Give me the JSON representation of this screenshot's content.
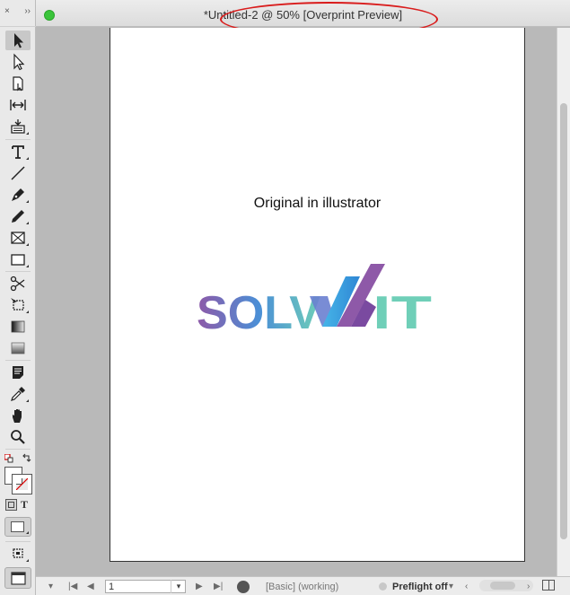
{
  "window": {
    "title": "*Untitled-2 @ 50% [Overprint Preview]"
  },
  "tools_panel": {
    "collapse_glyph": "››",
    "close_glyph": "×",
    "tools": [
      {
        "name": "selection-tool",
        "icon": "arrow-icon"
      },
      {
        "name": "direct-selection-tool",
        "icon": "hollow-arrow-icon"
      },
      {
        "name": "page-tool",
        "icon": "page-icon"
      },
      {
        "name": "gap-tool",
        "icon": "gap-icon"
      },
      {
        "name": "content-collector-tool",
        "icon": "collector-icon"
      },
      {
        "name": "type-tool",
        "icon": "type-icon"
      },
      {
        "name": "line-tool",
        "icon": "line-icon"
      },
      {
        "name": "pen-tool",
        "icon": "pen-icon"
      },
      {
        "name": "pencil-tool",
        "icon": "pencil-icon"
      },
      {
        "name": "rectangle-frame-tool",
        "icon": "frame-icon"
      },
      {
        "name": "rectangle-tool",
        "icon": "rectangle-icon"
      },
      {
        "name": "scissors-tool",
        "icon": "scissors-icon"
      },
      {
        "name": "free-transform-tool",
        "icon": "transform-icon"
      },
      {
        "name": "gradient-swatch-tool",
        "icon": "gradient-icon"
      },
      {
        "name": "gradient-feather-tool",
        "icon": "feather-icon"
      },
      {
        "name": "note-tool",
        "icon": "note-icon"
      },
      {
        "name": "eyedropper-tool",
        "icon": "eyedropper-icon"
      },
      {
        "name": "hand-tool",
        "icon": "hand-icon"
      },
      {
        "name": "zoom-tool",
        "icon": "zoom-icon"
      }
    ],
    "type_glyph": "T"
  },
  "document": {
    "caption": "Original in illustrator",
    "logo_text_left": "SOLV",
    "logo_text_right": "IT",
    "colors": {
      "purple": "#8e59a8",
      "blue": "#3f91d9",
      "teal": "#6fcfb8",
      "highlight": "#d91c1c"
    }
  },
  "status_bar": {
    "page_number": "1",
    "profile": "[Basic] (working)",
    "preflight": "Preflight off"
  }
}
